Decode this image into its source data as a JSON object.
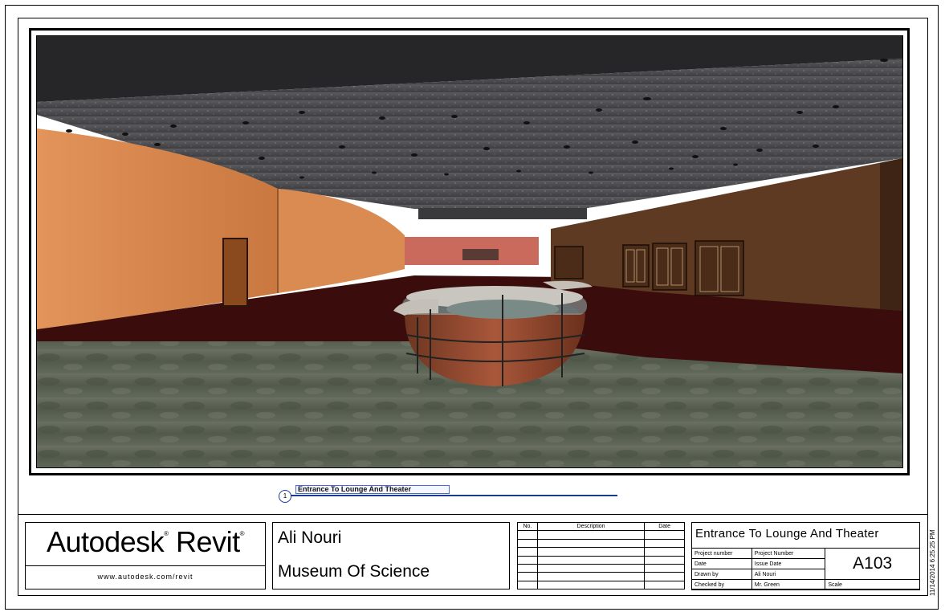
{
  "viewport": {
    "view_number": "1",
    "view_name": "Entrance To Lounge And Theater"
  },
  "title_block": {
    "logo": {
      "brand": "Autodesk",
      "product": "Revit",
      "registered": "®",
      "url": "www.autodesk.com/revit"
    },
    "owner": "Ali Nouri",
    "project": "Museum Of Science",
    "revisions": {
      "headers": [
        "No.",
        "Description",
        "Date"
      ],
      "rows": [
        [
          "",
          "",
          ""
        ],
        [
          "",
          "",
          ""
        ],
        [
          "",
          "",
          ""
        ],
        [
          "",
          "",
          ""
        ],
        [
          "",
          "",
          ""
        ],
        [
          "",
          "",
          ""
        ],
        [
          "",
          "",
          ""
        ]
      ]
    },
    "sheet_name": "Entrance To Lounge And Theater",
    "fields": {
      "project_number_label": "Project number",
      "project_number": "Project Number",
      "date_label": "Date",
      "date": "Issue Date",
      "drawn_by_label": "Drawn by",
      "drawn_by": "Ali Nouri",
      "checked_by_label": "Checked by",
      "checked_by": "Mr. Green",
      "scale_label": "Scale",
      "scale": ""
    },
    "sheet_number": "A103",
    "timestamp": "11/14/2014 6:25:25 PM"
  },
  "colors": {
    "ceiling": "#4a4a4d",
    "soffit": "#262628",
    "wall_left": "#d6884c",
    "wall_right": "#5e3a22",
    "carpet": "#3a0d0c",
    "floor": "#5d6455",
    "desk_brick": "#9a4a2c",
    "accent_blue": "#1b3a8f"
  }
}
